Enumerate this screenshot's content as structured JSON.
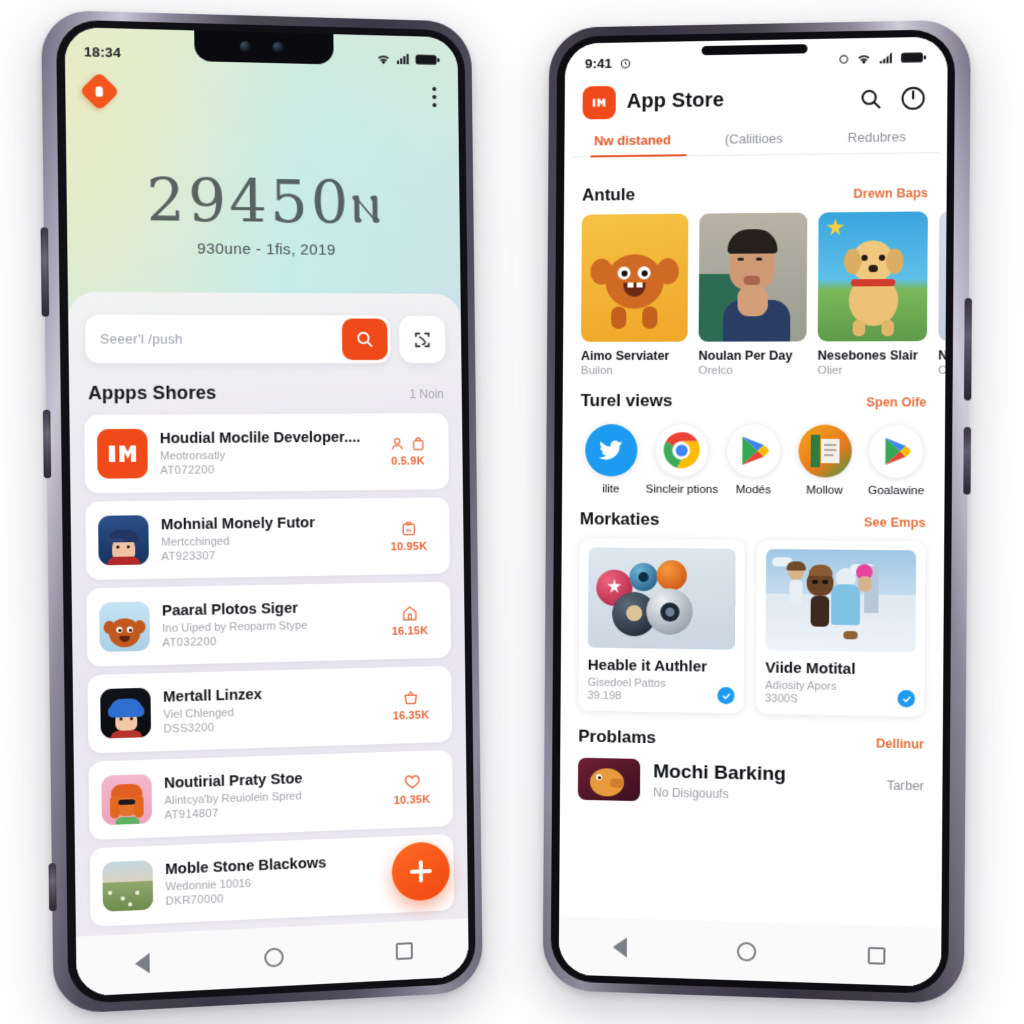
{
  "left_phone": {
    "status_bar": {
      "time": "18:34",
      "wifi_icon": "wifi-icon",
      "signal_icon": "signal-icon",
      "battery_icon": "battery-icon"
    },
    "badge_icon": "alert-badge-icon",
    "overflow_icon": "kebab-menu-icon",
    "wallpaper": {
      "headline": "29450ⲛ",
      "subline": "930une - 1ﬁs, 2019"
    },
    "search": {
      "placeholder": "Seeer'l /push",
      "search_icon": "search-icon",
      "scan_icon": "scan-icon"
    },
    "section": {
      "title": "Appps Shores",
      "meta": "1 Noin"
    },
    "apps": [
      {
        "name": "Houdial Moclile Developer....",
        "sub": "Meotronsatly",
        "code": "AT072200",
        "count": "0.5.9K",
        "icons": [
          "person-icon",
          "bag-icon"
        ],
        "icon_art": "mi-logo"
      },
      {
        "name": "Mohnial Monely Futor",
        "sub": "Mertcchinged",
        "code": "AT923307",
        "count": "10.95K",
        "icons": [
          "clipboard-icon"
        ],
        "icon_art": "boy-cap"
      },
      {
        "name": "Paaral Plotos Siger",
        "sub": "Ino Uiped by Reoparm Stype",
        "code": "AT032200",
        "count": "16.15K",
        "icons": [
          "house-icon"
        ],
        "icon_art": "fuzzy-monster"
      },
      {
        "name": "Mertall Linzex",
        "sub": "Viel Chlenged",
        "code": "DSS3200",
        "count": "16.35K",
        "icons": [
          "basket-icon"
        ],
        "icon_art": "blue-hair-kid"
      },
      {
        "name": "Noutirial Praty Stoe",
        "sub": "Alintcya'by Reuiolein Spred",
        "code": "AT914807",
        "count": "10.35K",
        "icons": [
          "heart-icon"
        ],
        "icon_art": "pink-hat-girl"
      },
      {
        "name": "Moble Stone Blackows",
        "sub": "Wedonnie 10016",
        "code": "DKR70000",
        "count": "",
        "icons": [],
        "icon_art": "meadow"
      }
    ],
    "fab_icon": "add-plus-icon",
    "nav": {
      "back_icon": "nav-back-icon",
      "home_icon": "nav-home-icon",
      "recents_icon": "nav-recents-icon"
    }
  },
  "right_phone": {
    "status_bar": {
      "time": "9:41",
      "alarm_icon": "alarm-icon",
      "dot_icon": "dot-icon",
      "wifi_icon": "wifi-icon",
      "signal_icon": "signal-icon",
      "battery_icon": "battery-icon"
    },
    "appbar": {
      "logo_icon": "mi-logo-icon",
      "title": "App Store",
      "search_icon": "search-icon",
      "account_icon": "account-icon"
    },
    "tabs": [
      {
        "label": "Nw distaned",
        "active": true
      },
      {
        "label": "(Caliitioes",
        "active": false
      },
      {
        "label": "Redubres",
        "active": false
      }
    ],
    "sections": [
      {
        "title": "Antule",
        "action": "Drewn Baps",
        "type": "carousel",
        "cards": [
          {
            "name": "Aimo Serviater",
            "sub": "Builon",
            "art": "fuzzy-monster-yellow"
          },
          {
            "name": "Noulan Per Day",
            "sub": "Orelco",
            "art": "man-portrait"
          },
          {
            "name": "Nesebones Slair",
            "sub": "Olier",
            "art": "puppy-sky"
          },
          {
            "name": "Naom N",
            "sub": "Chelin",
            "art": "curly-person"
          }
        ]
      },
      {
        "title": "Turel views",
        "action": "Spen Oife",
        "type": "icons",
        "apps": [
          {
            "name": "ilite",
            "art": "twitter"
          },
          {
            "name": "Sincleir ptions",
            "art": "chrome"
          },
          {
            "name": "Modés",
            "art": "play"
          },
          {
            "name": "Mollow",
            "art": "orange-circle"
          },
          {
            "name": "Goalawine",
            "art": "play"
          }
        ]
      },
      {
        "title": "Morkaties",
        "action": "See Emps",
        "type": "grid",
        "cards": [
          {
            "name": "Heable it Authler",
            "sub": "Gisedoel Pattos",
            "code": "39.198",
            "badge": "verified-icon",
            "art": "spheres"
          },
          {
            "name": "Viide Motital",
            "sub": "Adiosity Apors",
            "code": "3300S",
            "badge": "verified-icon",
            "art": "city-characters"
          }
        ]
      },
      {
        "title": "Problams",
        "action": "Dellinur",
        "type": "row",
        "item": {
          "name": "Mochi Barking",
          "sub": "No Disigouufs",
          "action": "Taгber",
          "art": "dark-creature"
        }
      }
    ],
    "nav": {
      "back_icon": "nav-back-icon",
      "home_icon": "nav-home-icon",
      "recents_icon": "nav-recents-icon"
    }
  },
  "colors": {
    "accent_orange": "#f0491a",
    "tab_orange": "#e2572c",
    "count_orange": "#e5663a",
    "verified_blue": "#1d9bf0"
  }
}
